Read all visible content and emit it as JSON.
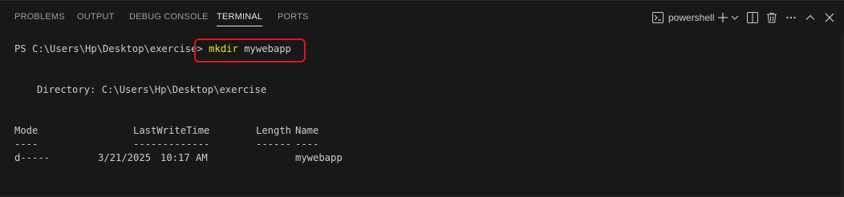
{
  "tabs": {
    "problems": "PROBLEMS",
    "output": "OUTPUT",
    "debug_console": "DEBUG CONSOLE",
    "terminal": "TERMINAL",
    "ports": "PORTS",
    "active": "TERMINAL"
  },
  "actions": {
    "shell_name": "powershell",
    "icons": [
      "terminal-shell-icon",
      "add-icon",
      "chevron-down-icon",
      "split-icon",
      "trash-icon",
      "more-icon",
      "maximize-icon",
      "close-icon"
    ]
  },
  "terminal": {
    "prompt": "PS C:\\Users\\Hp\\Desktop\\exercise>",
    "command": "mkdir",
    "argument": "mywebapp",
    "directory_line": "Directory: C:\\Users\\Hp\\Desktop\\exercise",
    "headers": {
      "mode": "Mode",
      "last_write_time": "LastWriteTime",
      "length": "Length",
      "name": "Name"
    },
    "separators": {
      "mode": "----",
      "last_write_time": "-------------",
      "length": "------",
      "name": "----"
    },
    "row": {
      "mode": "d-----",
      "date": "3/21/2025",
      "time": "10:17 AM",
      "name": "mywebapp"
    }
  },
  "colors": {
    "background": "#181818",
    "command": "#e5e510",
    "highlight_border": "#e0141e",
    "text": "#cccccc"
  }
}
